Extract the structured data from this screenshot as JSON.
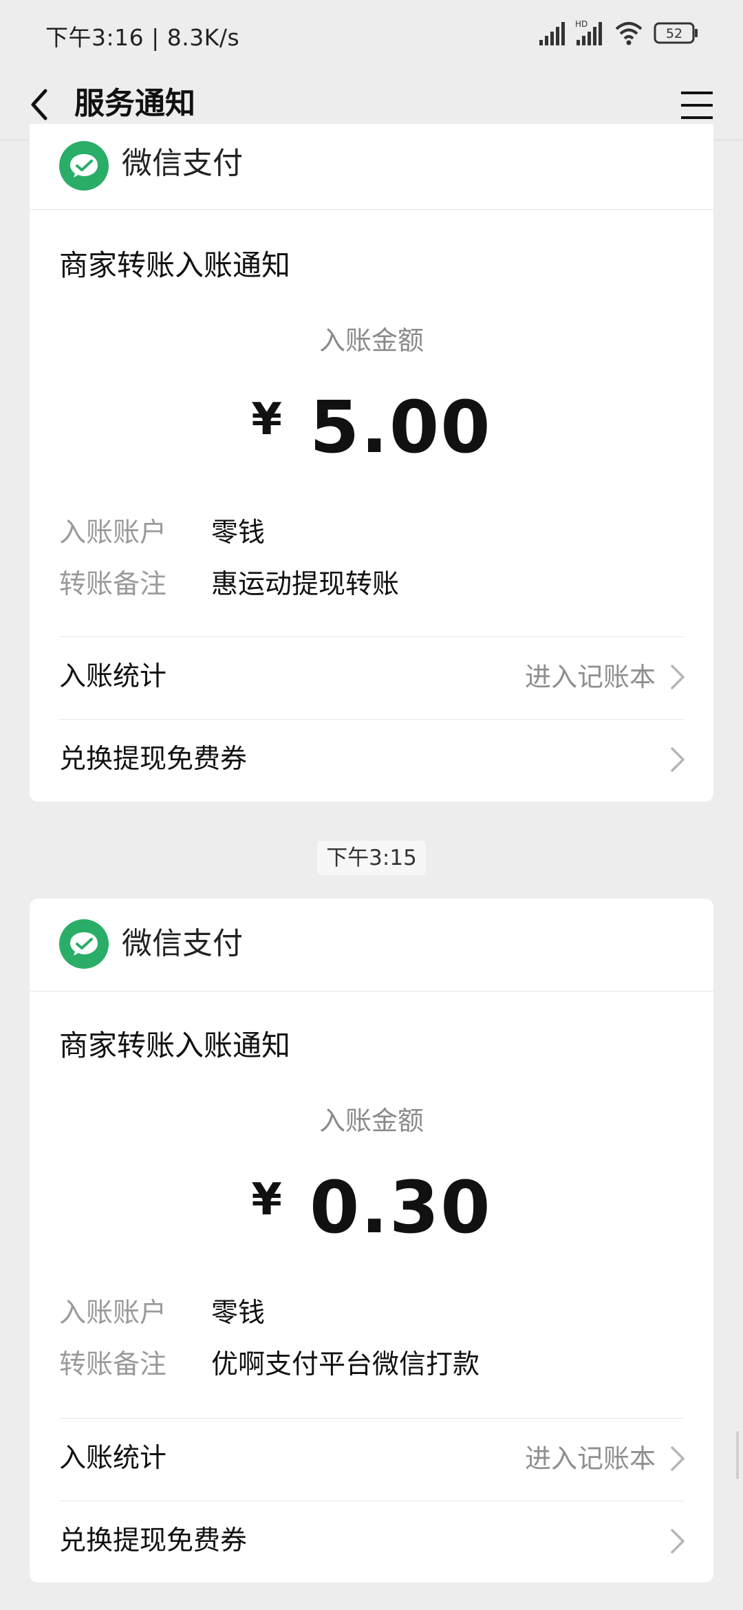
{
  "status_bar": {
    "time_speed": "下午3:16 | 8.3K/s",
    "hd_label": "HD",
    "battery": "52"
  },
  "nav": {
    "title": "服务通知"
  },
  "messages": [
    {
      "brand": "微信支付",
      "title": "商家转账入账通知",
      "amount_label": "入账金额",
      "currency": "¥",
      "amount": "5.00",
      "account_key": "入账账户",
      "account_value": "零钱",
      "remark_key": "转账备注",
      "remark_value": "惠运动提现转账",
      "stats_label": "入账统计",
      "stats_link": "进入记账本",
      "coupon_label": "兑换提现免费券"
    },
    {
      "brand": "微信支付",
      "title": "商家转账入账通知",
      "amount_label": "入账金额",
      "currency": "¥",
      "amount": "0.30",
      "account_key": "入账账户",
      "account_value": "零钱",
      "remark_key": "转账备注",
      "remark_value": "优啊支付平台微信打款",
      "stats_label": "入账统计",
      "stats_link": "进入记账本",
      "coupon_label": "兑换提现免费券"
    }
  ],
  "timestamp_divider": "下午3:15",
  "icons": {
    "back": "back-arrow-icon",
    "menu": "hamburger-menu-icon",
    "signal": "signal-icon",
    "wifi": "wifi-icon",
    "battery": "battery-icon",
    "brand": "wechat-pay-icon",
    "chevron": "chevron-right-icon"
  },
  "colors": {
    "background": "#ededed",
    "wechat_green": "#2aae67",
    "muted_text": "#9a9a9a"
  }
}
